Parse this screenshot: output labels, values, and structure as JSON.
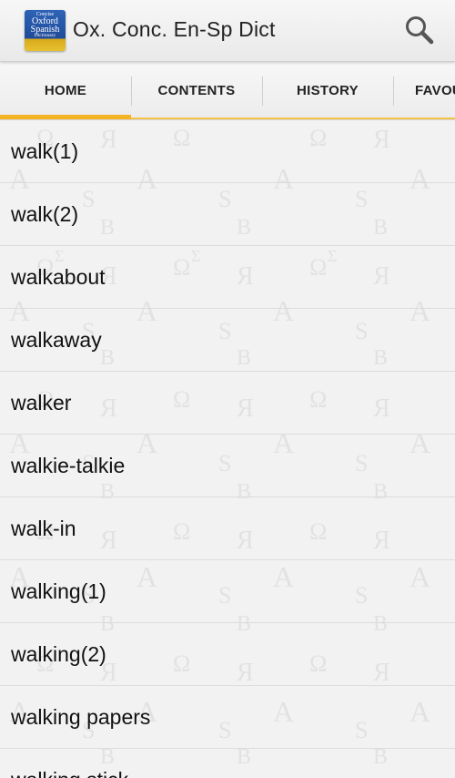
{
  "app": {
    "title": "Ox. Conc. En-Sp Dict",
    "icon_line1": "Concise",
    "icon_line2a": "Oxford",
    "icon_line2b": "Spanish",
    "icon_line3": "Dictionary"
  },
  "icons": {
    "app": "dictionary-app-icon",
    "search": "search-icon"
  },
  "tabs": [
    {
      "label": "HOME",
      "active": true
    },
    {
      "label": "CONTENTS",
      "active": false
    },
    {
      "label": "HISTORY",
      "active": false
    },
    {
      "label": "FAVOURITES",
      "active": false
    }
  ],
  "entries": [
    "walk(1)",
    "walk(2)",
    "walkabout",
    "walkaway",
    "walker",
    "walkie-talkie",
    "walk-in",
    "walking(1)",
    "walking(2)",
    "walking papers",
    "walking stick"
  ],
  "colors": {
    "accent": "#f5b324",
    "background": "#f2f2f2",
    "icon_blue": "#2d63b7",
    "icon_gold": "#e7c12f"
  }
}
